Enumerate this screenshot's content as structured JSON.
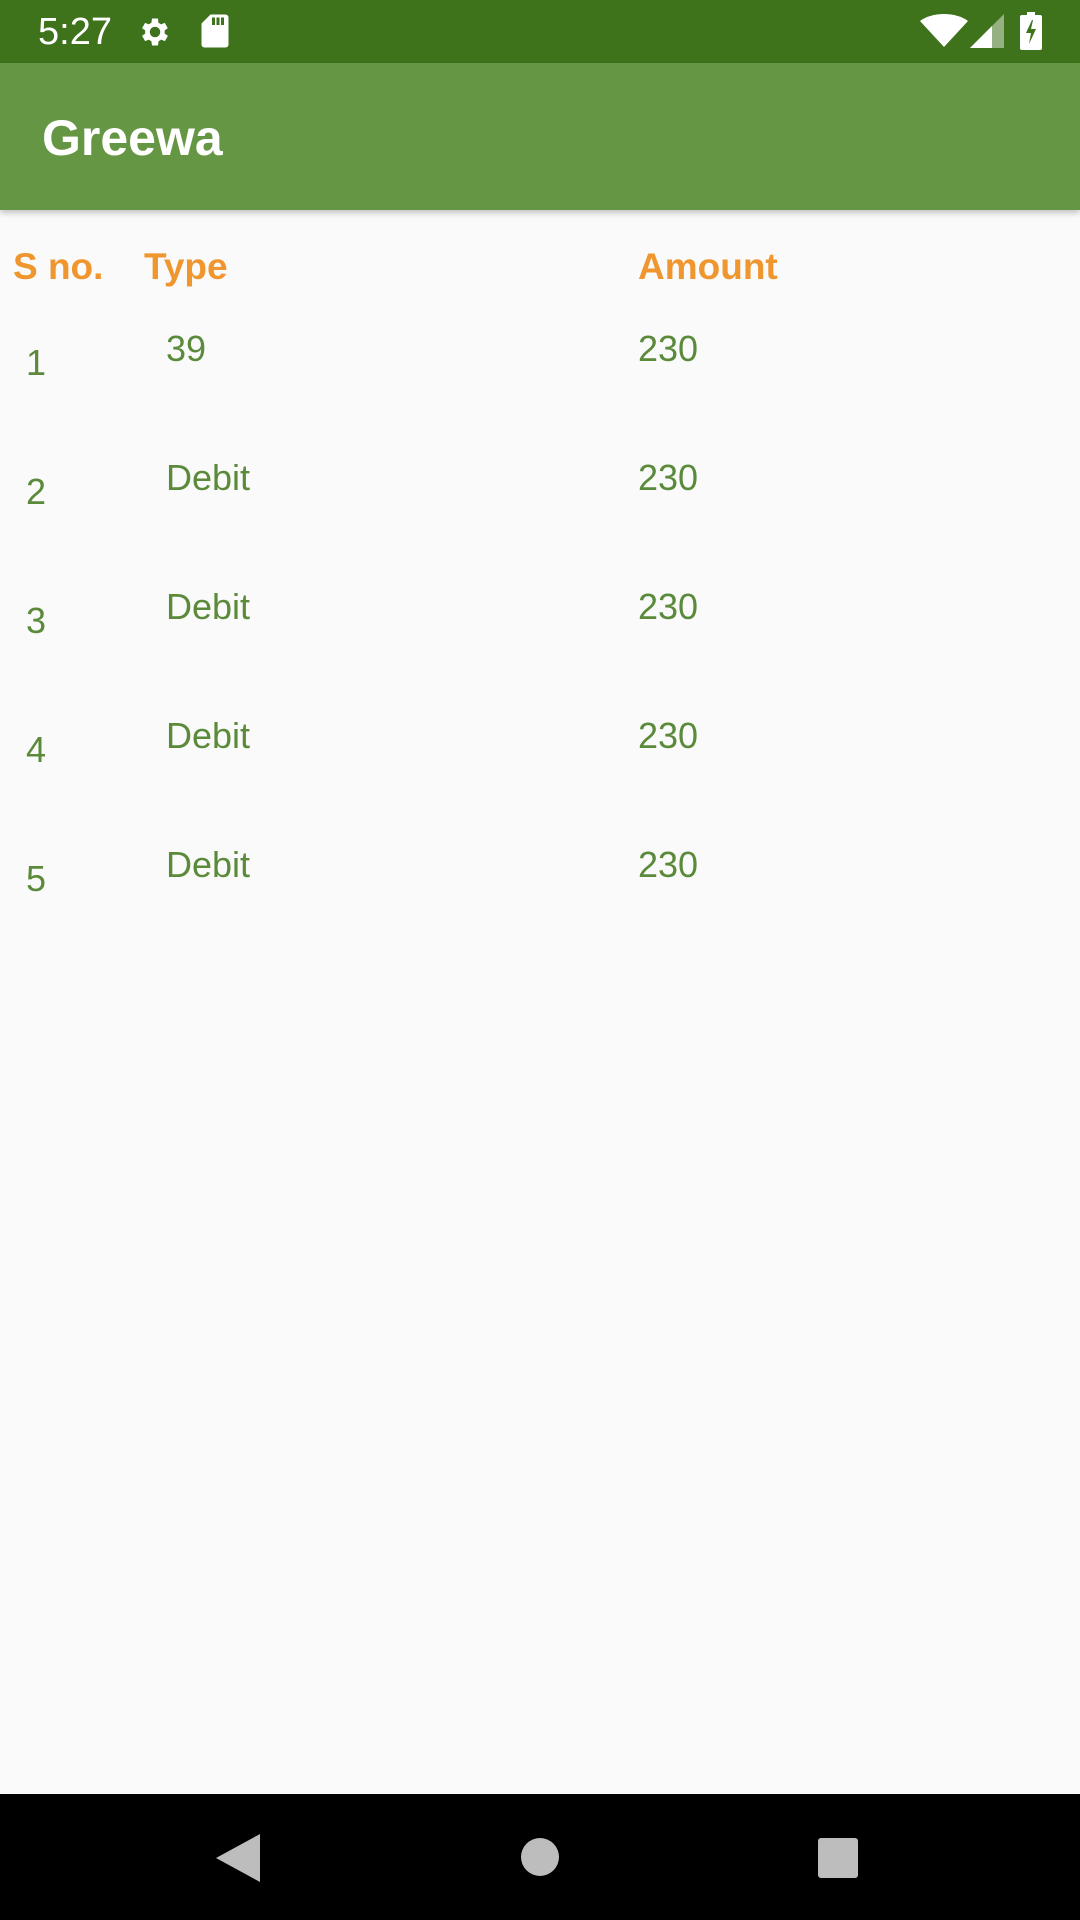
{
  "status_bar": {
    "time": "5:27",
    "icons": [
      "gear-icon",
      "sd-card-icon",
      "wifi-icon",
      "signal-icon",
      "battery-charging-icon"
    ],
    "background_color": "#3e721b"
  },
  "app_bar": {
    "title": "Greewa",
    "background_color": "#659643"
  },
  "table": {
    "headers": {
      "sno": "S no.",
      "type": "Type",
      "amount": "Amount"
    },
    "header_color": "#f0962e",
    "cell_color": "#5a8a3a",
    "rows": [
      {
        "sno": "1",
        "type": "39",
        "amount": "230"
      },
      {
        "sno": "2",
        "type": "Debit",
        "amount": "230"
      },
      {
        "sno": "3",
        "type": "Debit",
        "amount": "230"
      },
      {
        "sno": "4",
        "type": "Debit",
        "amount": "230"
      },
      {
        "sno": "5",
        "type": "Debit",
        "amount": "230"
      }
    ]
  },
  "nav_bar": {
    "buttons": [
      "back-icon",
      "home-icon",
      "recents-icon"
    ]
  }
}
